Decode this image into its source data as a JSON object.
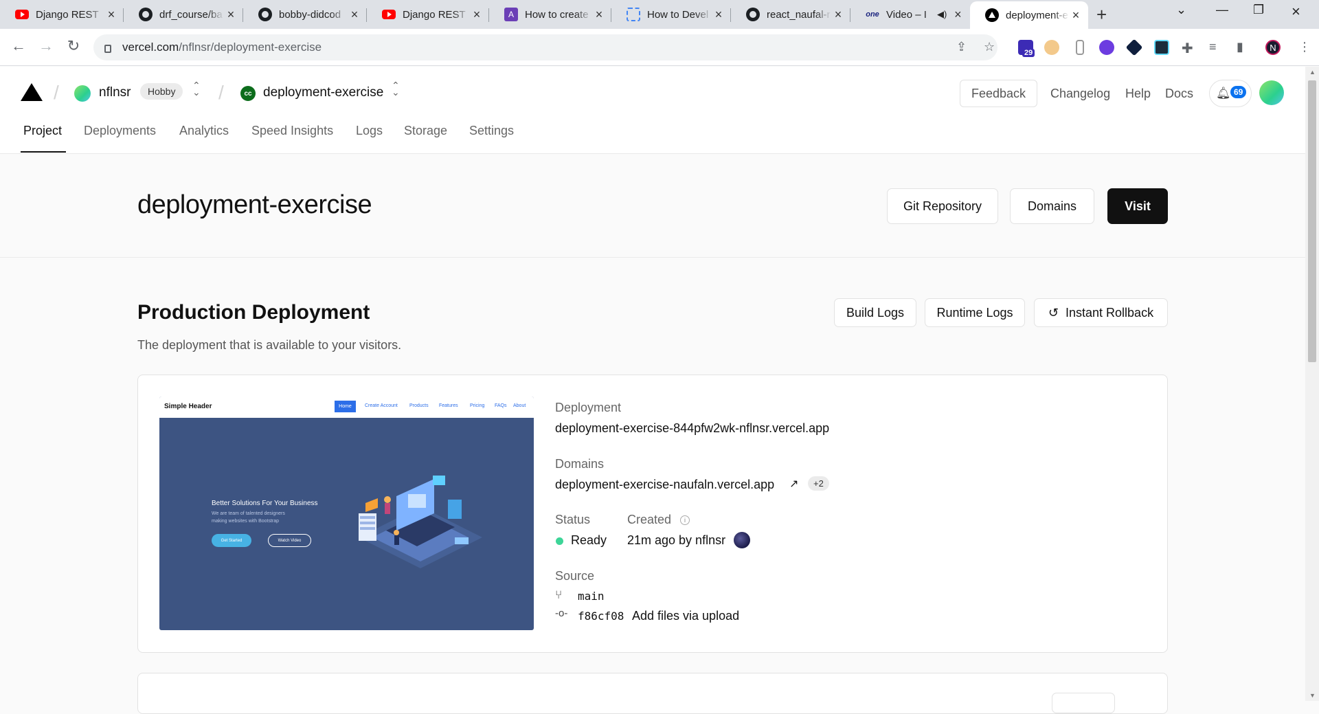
{
  "browser": {
    "tabs": [
      {
        "title": "Django REST",
        "icon": "youtube"
      },
      {
        "title": "drf_course/ba",
        "icon": "github"
      },
      {
        "title": "bobby-didcod",
        "icon": "github"
      },
      {
        "title": "Django REST",
        "icon": "youtube"
      },
      {
        "title": "How to create",
        "icon": "purple-a"
      },
      {
        "title": "How to Devel",
        "icon": "dashed"
      },
      {
        "title": "react_naufal-r",
        "icon": "github"
      },
      {
        "title": "Video – I",
        "icon": "one"
      },
      {
        "title": "deployment-e",
        "icon": "vercel"
      }
    ],
    "url_domain": "vercel.com",
    "url_path": "/nflnsr/deployment-exercise",
    "ext_badge": "29",
    "profile_letter": "N"
  },
  "header": {
    "team": "nflnsr",
    "plan": "Hobby",
    "project": "deployment-exercise",
    "project_icon_text": "cc",
    "feedback": "Feedback",
    "links": [
      "Changelog",
      "Help",
      "Docs"
    ],
    "notifications": "69"
  },
  "subnav": {
    "items": [
      "Project",
      "Deployments",
      "Analytics",
      "Speed Insights",
      "Logs",
      "Storage",
      "Settings"
    ],
    "active": "Project"
  },
  "project": {
    "title": "deployment-exercise",
    "buttons": {
      "git": "Git Repository",
      "domains": "Domains",
      "visit": "Visit"
    }
  },
  "production": {
    "title": "Production Deployment",
    "subtitle": "The deployment that is available to your visitors.",
    "buttons": {
      "build_logs": "Build Logs",
      "runtime_logs": "Runtime Logs",
      "rollback": "Instant Rollback"
    },
    "preview": {
      "brand": "Simple Header",
      "nav": [
        "Home",
        "Create Account",
        "Products",
        "Features",
        "Pricing",
        "FAQs",
        "About"
      ],
      "headline": "Better Solutions For Your Business",
      "text": "We are team of talented designers making websites with Bootstrap",
      "cta1": "Get Started",
      "cta2": "Watch Video"
    },
    "deployment_label": "Deployment",
    "deployment_url": "deployment-exercise-844pfw2wk-nflnsr.vercel.app",
    "domains_label": "Domains",
    "domain": "deployment-exercise-naufaln.vercel.app",
    "domains_more": "+2",
    "status_label": "Status",
    "status": "Ready",
    "created_label": "Created",
    "created": "21m ago by nflnsr",
    "source_label": "Source",
    "branch": "main",
    "commit": "f86cf08",
    "commit_msg": "Add files via upload",
    "status_color": "#3dd598"
  }
}
